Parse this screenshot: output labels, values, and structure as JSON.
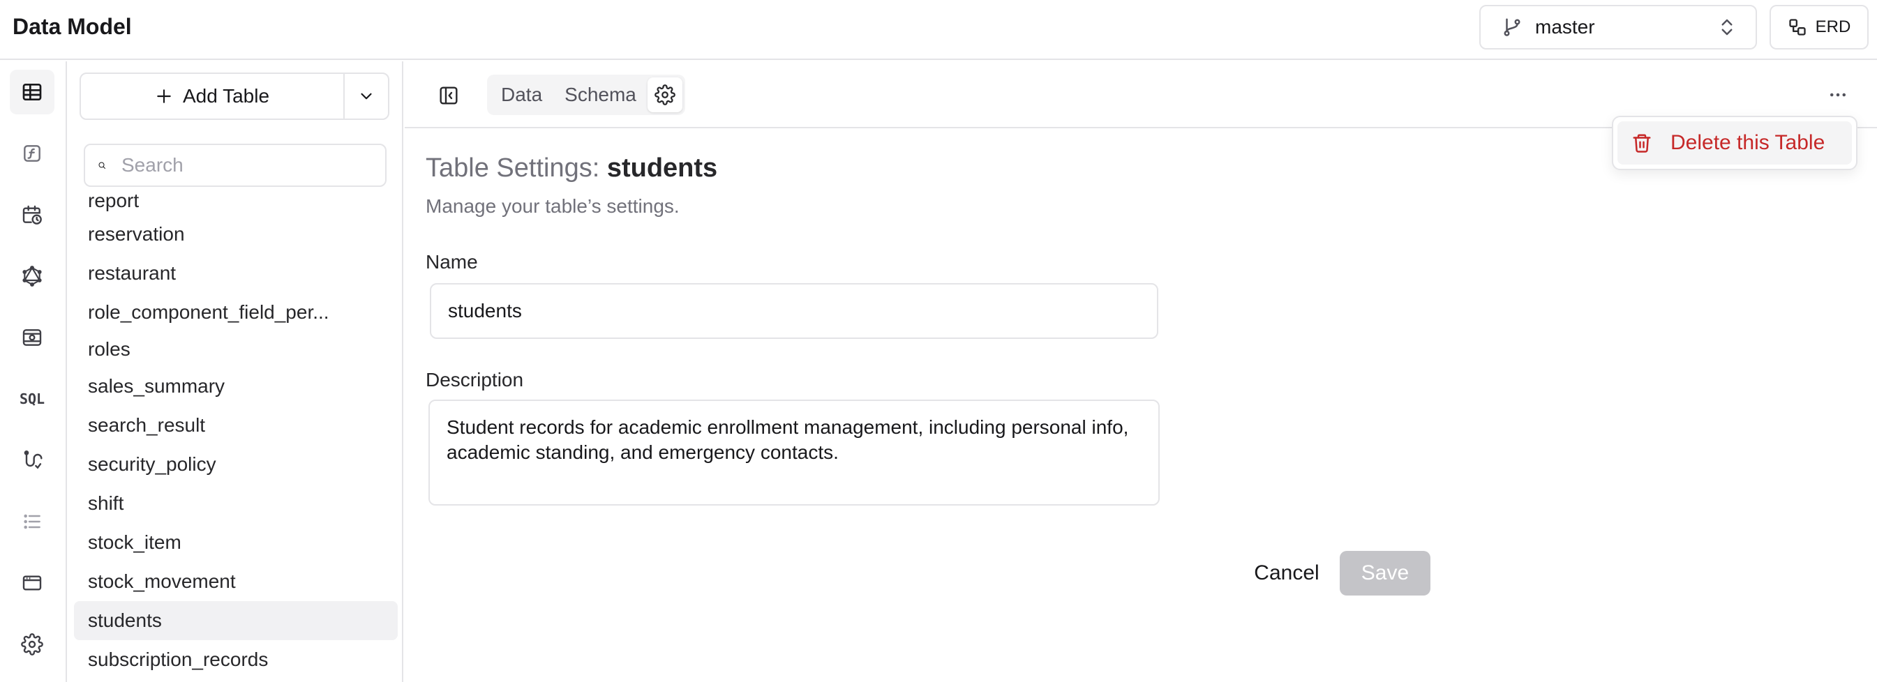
{
  "header": {
    "title": "Data Model",
    "branch": "master",
    "erd_label": "ERD"
  },
  "sidebar_rail": {
    "items": [
      "table-icon",
      "function-icon",
      "schedule-icon",
      "graphql-icon",
      "storage-icon",
      "sql-icon",
      "route-icon",
      "list-icon",
      "window-icon",
      "gear-icon"
    ],
    "sql_label": "SQL"
  },
  "tables_panel": {
    "add_label": "Add Table",
    "search_placeholder": "Search",
    "items": [
      "report",
      "reservation",
      "restaurant",
      "role_component_field_per...",
      "roles",
      "sales_summary",
      "search_result",
      "security_policy",
      "shift",
      "stock_item",
      "stock_movement",
      "students",
      "subscription_records"
    ],
    "selected": "students"
  },
  "toolbar": {
    "tabs": [
      "Data",
      "Schema"
    ]
  },
  "settings": {
    "title_prefix": "Table Settings:",
    "table_name": "students",
    "subtitle": "Manage your table’s settings.",
    "name_label": "Name",
    "name_value": "students",
    "description_label": "Description",
    "description_value": "Student records for academic enrollment management, including personal info, academic standing, and emergency contacts.",
    "cancel_label": "Cancel",
    "save_label": "Save"
  },
  "menu": {
    "delete_label": "Delete this Table"
  },
  "colors": {
    "danger": "#c62828",
    "border": "#e4e4e7",
    "selected_bg": "#f1f1f3",
    "disabled_button": "#c4c4c8"
  }
}
